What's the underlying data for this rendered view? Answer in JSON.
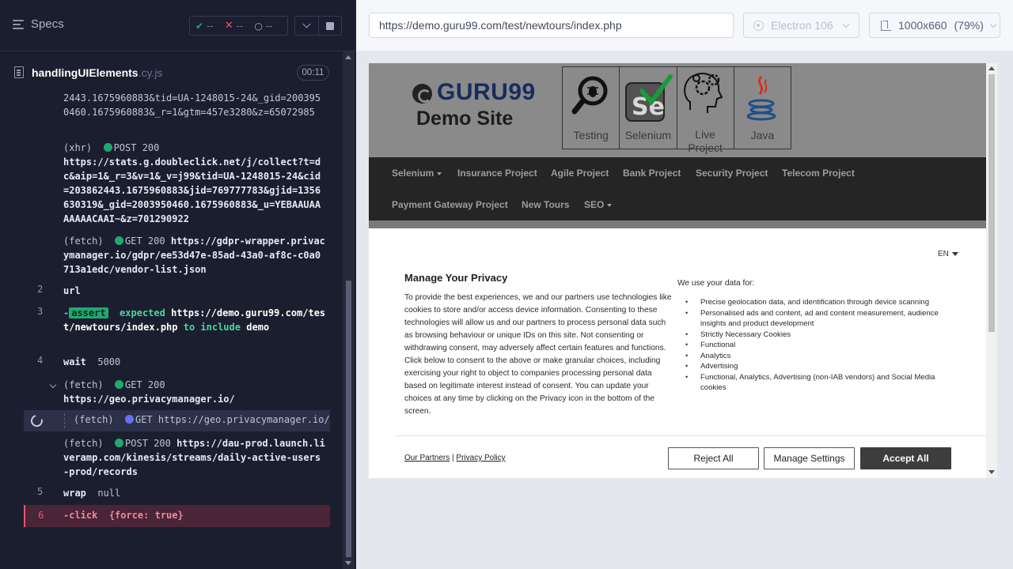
{
  "reporter": {
    "specs_label": "Specs",
    "stats": {
      "passed": "--",
      "failed": "--",
      "pending": "--"
    },
    "spec": {
      "name": "handlingUIElements",
      "ext": ".cy.js",
      "duration": "00:11"
    },
    "commands": {
      "c0": "2443.1675960883&tid=UA-1248015-24&_gid=2003950460.1675960883&_r=1&gtm=457e3280&z=65072985",
      "c1_type": "(xhr)",
      "c1_method": "POST 200",
      "c1_url": "https://stats.g.doubleclick.net/j/collect?t=dc&aip=1&_r=3&v=1&_v=j99&tid=UA-1248015-24&cid=203862443.1675960883&jid=769777783&gjid=1356630319&_gid=2003950460.1675960883&_u=YEBAAUAAAAAAACAAI~&z=701290922",
      "c2_type": "(fetch)",
      "c2_method": "GET 200",
      "c2_url": "https://gdpr-wrapper.privacymanager.io/gdpr/ee53d47e-85ad-43a0-af8c-c0a0713a1edc/vendor-list.json",
      "c3_num": "2",
      "c3_name": "url",
      "c4_num": "3",
      "c4_prefix": "-",
      "c4_badge": "assert",
      "c4_expected": "expected",
      "c4_url": "https://demo.guru99.com/test/newtours/index.php",
      "c4_to": "to include",
      "c4_val": "demo",
      "c5_num": "4",
      "c5_name": "wait",
      "c5_arg": "5000",
      "c6_type": "(fetch)",
      "c6_method": "GET 200",
      "c6_url": "https://geo.privacymanager.io/",
      "c7_type": "(fetch)",
      "c7_method": "GET https://geo.privacymanager.io/",
      "c8_type": "(fetch)",
      "c8_method": "POST 200",
      "c8_url": "https://dau-prod.launch.liveramp.com/kinesis/streams/daily-active-users-prod/records",
      "c9_num": "5",
      "c9_name": "wrap",
      "c9_arg": "null",
      "c10_num": "6",
      "c10_name": "-click",
      "c10_arg": "{force: true}"
    }
  },
  "aut": {
    "url": "https://demo.guru99.com/test/newtours/index.php",
    "browser": "Electron 106",
    "viewport": "1000x660",
    "zoom": "(79%)"
  },
  "site": {
    "logo_guru": "GURU99",
    "logo_demo": "Demo Site",
    "tiles": [
      "Testing",
      "Selenium",
      "Live Project",
      "Java"
    ],
    "nav": [
      "Selenium",
      "Insurance Project",
      "Agile Project",
      "Bank Project",
      "Security Project",
      "Telecom Project",
      "Payment Gateway Project",
      "New Tours",
      "SEO"
    ]
  },
  "consent": {
    "lang": "EN",
    "title": "Manage Your Privacy",
    "body1": "To provide the best experiences, we and our partners use technologies like cookies to store and/or access device information. Consenting to these technologies will allow us and our partners to process personal data such as browsing behaviour or unique IDs on this site. Not consenting or withdrawing consent, may adversely affect certain features and functions.",
    "body2": "Click below to consent to the above or make granular choices, including exercising your right to object to companies processing personal data based on legitimate interest instead of consent. You can update your choices at any time by clicking on the Privacy icon in the bottom of the screen.",
    "right_head": "We use your data for:",
    "purposes": [
      "Precise geolocation data, and identification through device scanning",
      "Personalised ads and content, ad and content measurement, audience insights and product development",
      "Strictly Necessary Cookies",
      "Functional",
      "Analytics",
      "Advertising",
      "Functional, Analytics, Advertising (non-IAB vendors) and Social Media cookies"
    ],
    "partners": "Our Partners",
    "sep": "|",
    "policy": "Privacy Policy",
    "reject": "Reject All",
    "manage": "Manage Settings",
    "accept": "Accept All"
  },
  "colors": {
    "pass": "#1fa971",
    "fail": "#e45770",
    "pending": "#6470f3",
    "accept": "#3d3d3d"
  }
}
